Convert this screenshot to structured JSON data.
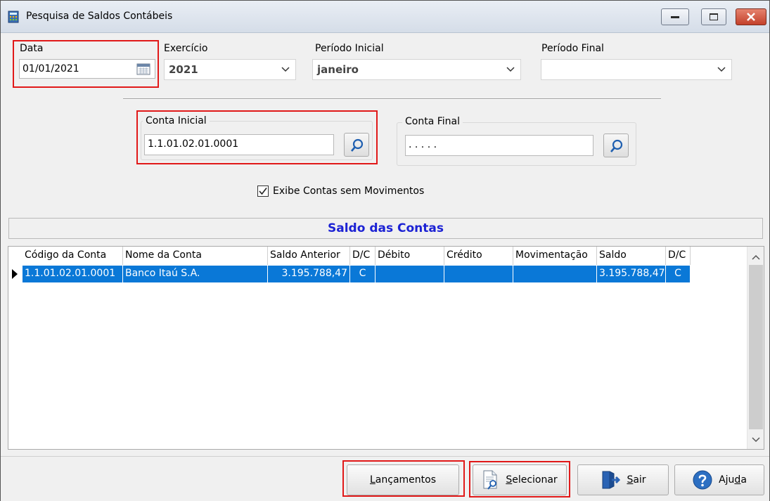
{
  "window": {
    "title": "Pesquisa de Saldos Contábeis"
  },
  "filters": {
    "data_label": "Data",
    "data_value": "01/01/2021",
    "exercicio_label": "Exercício",
    "exercicio_value": "2021",
    "periodo_inicial_label": "Período Inicial",
    "periodo_inicial_value": "janeiro",
    "periodo_final_label": "Período Final",
    "periodo_final_value": ""
  },
  "accounts": {
    "conta_inicial_label": "Conta Inicial",
    "conta_inicial_value": "1.1.01.02.01.0001",
    "conta_final_label": "Conta Final",
    "conta_final_value": ". . . . ."
  },
  "options": {
    "exibe_sem_mov_label": "Exibe Contas sem Movimentos",
    "exibe_sem_mov_checked": true
  },
  "section": {
    "title": "Saldo das Contas"
  },
  "grid": {
    "columns": [
      "Código da Conta",
      "Nome da Conta",
      "Saldo Anterior",
      "D/C",
      "Débito",
      "Crédito",
      "Movimentação",
      "Saldo",
      "D/C"
    ],
    "rows": [
      [
        "1.1.01.02.01.0001",
        "Banco Itaú S.A.",
        "3.195.788,47",
        "C",
        "",
        "",
        "",
        "3.195.788,47",
        "C"
      ]
    ]
  },
  "footer": {
    "lancamentos_pre": "",
    "lancamentos_u": "L",
    "lancamentos_post": "ançamentos",
    "selecionar_u": "S",
    "selecionar_post": "elecionar",
    "sair_u": "S",
    "sair_post": "air",
    "ajuda_pre": "Aju",
    "ajuda_u": "d",
    "ajuda_post": "a"
  },
  "colors": {
    "selection": "#0a78d7",
    "section_title": "#1c22d4",
    "highlight": "#e11919"
  }
}
